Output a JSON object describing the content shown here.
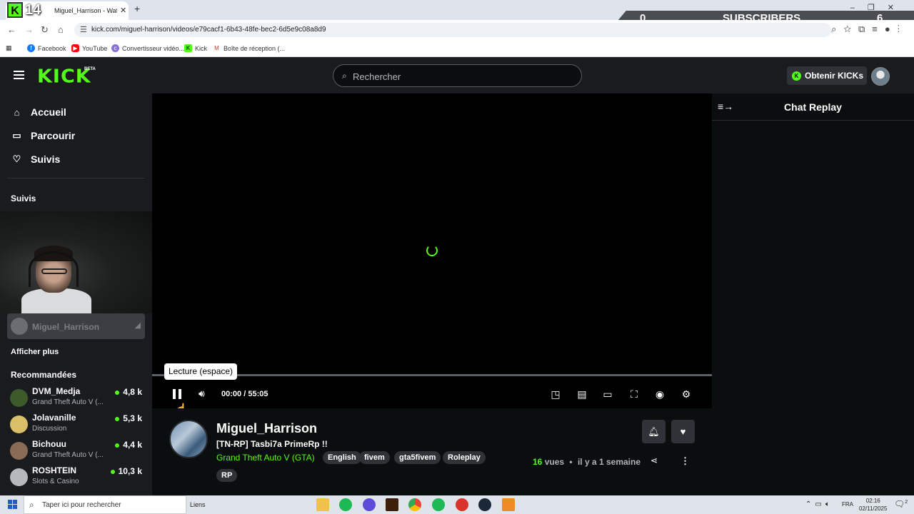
{
  "browser": {
    "tab_title": "Miguel_Harrison - Watch the V",
    "tab_close": "✕",
    "new_tab": "+",
    "url": "kick.com/miguel-harrison/videos/e79cacf1-6b43-48fe-bec2-6d5e9c08a8d9",
    "bookmarks": [
      "Facebook",
      "YouTube",
      "Convertisseur vidéo...",
      "Kick",
      "Boîte de réception (..."
    ]
  },
  "overlay": {
    "kick_badge_letter": "K",
    "kick_badge_number": "14",
    "subscribers_left": "0",
    "subscribers_label": "SUBSCRIBERS",
    "subscribers_right": "6"
  },
  "header": {
    "logo": "KICK",
    "beta": "BETA",
    "search_placeholder": "Rechercher",
    "get_kicks": "Obtenir KICKs"
  },
  "sidebar": {
    "nav": [
      "Accueil",
      "Parcourir",
      "Suivis"
    ],
    "followed_title": "Suivis",
    "followed_channel": "Miguel_Harrison",
    "show_more": "Afficher plus",
    "recommended_title": "Recommandées",
    "recommended": [
      {
        "name": "DVM_Medja",
        "category": "Grand Theft Auto V (...",
        "viewers": "4,8 k",
        "color": "#3c5a2a"
      },
      {
        "name": "Jolavanille",
        "category": "Discussion",
        "viewers": "5,3 k",
        "color": "#d9c068"
      },
      {
        "name": "Bichouu",
        "category": "Grand Theft Auto V (...",
        "viewers": "4,4 k",
        "color": "#8a6b55"
      },
      {
        "name": "ROSHTEIN",
        "category": "Slots & Casino",
        "viewers": "10,3 k",
        "color": "#b5b8bc"
      }
    ]
  },
  "player": {
    "tooltip": "Lecture (espace)",
    "time_current": "00:00",
    "time_separator": "/",
    "time_total": "55:05",
    "progress_fraction": 0
  },
  "chat": {
    "title": "Chat Replay"
  },
  "stream": {
    "streamer": "Miguel_Harrison",
    "title": "[TN-RP] Tasbi7a PrimeRp !!",
    "category": "Grand Theft Auto V (GTA)",
    "tags": [
      "English",
      "fivem",
      "gta5fivem",
      "Roleplay",
      "RP"
    ],
    "views_count": "16",
    "views_label": "vues",
    "separator": "•",
    "posted": "il y a 1 semaine"
  },
  "taskbar": {
    "search_placeholder": "Taper ici pour rechercher",
    "links": "Liens",
    "language": "FRA",
    "time": "02:16",
    "date": "02/11/2025",
    "notifications": "2"
  },
  "colors": {
    "accent": "#53fc18",
    "background": "#0b0e0f",
    "panel": "#191b1f"
  }
}
